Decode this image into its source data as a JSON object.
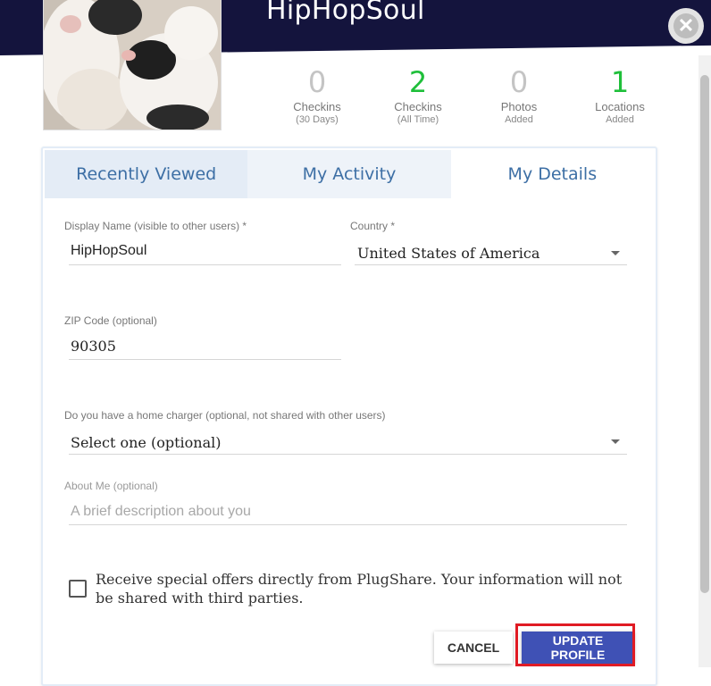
{
  "profile": {
    "username": "HipHopSoul",
    "avatar_alt": "avatar"
  },
  "stats": [
    {
      "value": "0",
      "label": "Checkins",
      "sub": "(30 Days)",
      "color": "#c4c4c4"
    },
    {
      "value": "2",
      "label": "Checkins",
      "sub": "(All Time)",
      "color": "#1fbf3a"
    },
    {
      "value": "0",
      "label": "Photos",
      "sub": "Added",
      "color": "#c4c4c4"
    },
    {
      "value": "1",
      "label": "Locations",
      "sub": "Added",
      "color": "#1fbf3a"
    }
  ],
  "tabs": [
    {
      "label": "Recently Viewed"
    },
    {
      "label": "My Activity"
    },
    {
      "label": "My Details"
    }
  ],
  "form": {
    "display_name": {
      "label": "Display Name (visible to other users) *",
      "value": "HipHopSoul"
    },
    "country": {
      "label": "Country *",
      "value": "United States of America"
    },
    "zip": {
      "label": "ZIP Code (optional)",
      "value": "90305"
    },
    "home_charger": {
      "label": "Do you have a home charger (optional, not shared with other users)",
      "value": "Select one (optional)"
    },
    "about_me": {
      "label": "About Me (optional)",
      "placeholder": "A brief description about you"
    },
    "offers_text": "Receive special offers directly from PlugShare. Your information will not be shared with third parties."
  },
  "buttons": {
    "cancel": "CANCEL",
    "update": "UPDATE PROFILE"
  },
  "colors": {
    "banner": "#14143d",
    "accent": "#3f51b5",
    "tab_text": "#3d6fa5",
    "green": "#1fbf3a",
    "highlight": "#e01b24"
  },
  "icons": {
    "close": "close-icon",
    "dropdown": "chevron-down-icon"
  }
}
